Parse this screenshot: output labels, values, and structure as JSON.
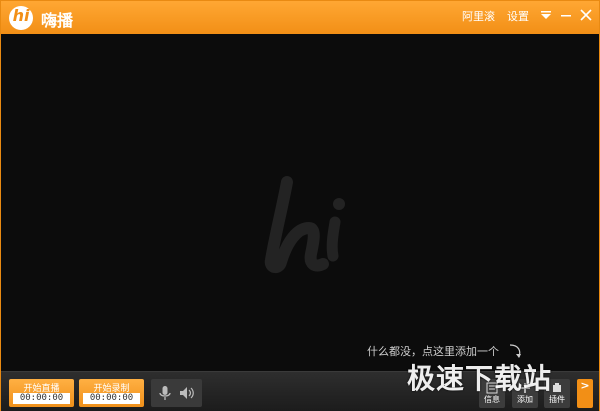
{
  "window": {
    "app_title": "嗨播",
    "logo_glyph": "hi",
    "title_links": {
      "aliyun": "阿里滚",
      "settings": "设置"
    }
  },
  "stage": {
    "watermark_glyph": "hi",
    "hint": "什么都没，点这里添加一个"
  },
  "toolbar": {
    "live": {
      "label": "开始直播",
      "time": "00:00:00"
    },
    "record": {
      "label": "开始录制",
      "time": "00:00:00"
    },
    "info_label": "信息",
    "add_label": "添加",
    "plugin_label": "插件",
    "expand_label": ">"
  },
  "site_watermark": "极速下载站",
  "colors": {
    "accent": "#f28f16",
    "background": "#0c0c0c",
    "toolbar": "#262626"
  }
}
